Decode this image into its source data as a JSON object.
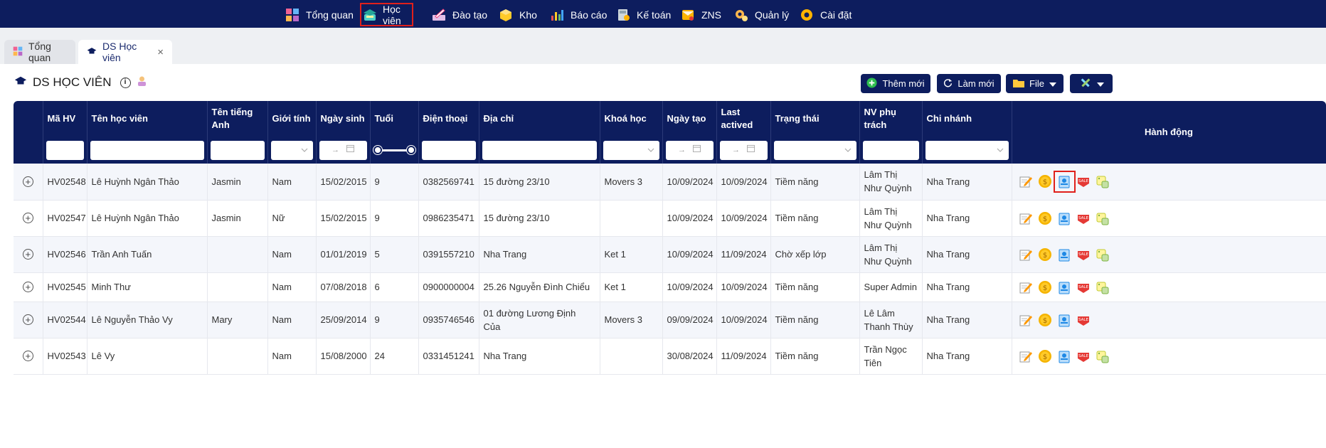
{
  "nav": [
    {
      "label": "Tổng quan",
      "icon": "dashboard-icon"
    },
    {
      "label": "Học viên",
      "icon": "student-cap-icon",
      "active": true
    },
    {
      "label": "Đào tạo",
      "icon": "training-icon"
    },
    {
      "label": "Kho",
      "icon": "warehouse-box-icon"
    },
    {
      "label": "Báo cáo",
      "icon": "report-chart-icon"
    },
    {
      "label": "Kế toán",
      "icon": "accounting-icon"
    },
    {
      "label": "ZNS",
      "icon": "zns-mail-icon"
    },
    {
      "label": "Quản lý",
      "icon": "management-icon"
    },
    {
      "label": "Cài đặt",
      "icon": "settings-gear-icon"
    }
  ],
  "tabs": {
    "overview": "Tổng quan",
    "students": "DS Học viên",
    "close": "×"
  },
  "page": {
    "title": "DS HỌC VIÊN",
    "info": "i"
  },
  "toolbar": {
    "add": "Thêm mới",
    "refresh": "Làm mới",
    "file": "File"
  },
  "columns": {
    "code": "Mã HV",
    "name": "Tên học viên",
    "english_name": "Tên tiếng Anh",
    "gender": "Giới tính",
    "dob": "Ngày sinh",
    "age": "Tuổi",
    "phone": "Điện thoại",
    "address": "Địa chỉ",
    "course": "Khoá học",
    "created": "Ngày tạo",
    "last_active": "Last actived",
    "status": "Trạng thái",
    "staff": "NV phụ trách",
    "branch": "Chi nhánh",
    "actions": "Hành động"
  },
  "filters": {
    "date_arrow": "→"
  },
  "rows": [
    {
      "code": "HV02548",
      "name": "Lê Huỳnh Ngân Thảo",
      "english_name": "Jasmin",
      "gender": "Nam",
      "dob": "15/02/2015",
      "age": "9",
      "phone": "0382569741",
      "address": "15 đường 23/10",
      "course": "Movers 3",
      "created": "10/09/2024",
      "last_active": "10/09/2024",
      "status": "Tiềm năng",
      "staff": "Lâm Thị Như Quỳnh",
      "branch": "Nha Trang"
    },
    {
      "code": "HV02547",
      "name": "Lê Huỳnh Ngân Thảo",
      "english_name": "Jasmin",
      "gender": "Nữ",
      "dob": "15/02/2015",
      "age": "9",
      "phone": "0986235471",
      "address": "15 đường 23/10",
      "course": "",
      "created": "10/09/2024",
      "last_active": "10/09/2024",
      "status": "Tiềm năng",
      "staff": "Lâm Thị Như Quỳnh",
      "branch": "Nha Trang"
    },
    {
      "code": "HV02546",
      "name": "Trần Anh Tuấn",
      "english_name": "",
      "gender": "Nam",
      "dob": "01/01/2019",
      "age": "5",
      "phone": "0391557210",
      "address": "Nha Trang",
      "course": "Ket 1",
      "created": "10/09/2024",
      "last_active": "11/09/2024",
      "status": "Chờ xếp lớp",
      "staff": "Lâm Thị Như Quỳnh",
      "branch": "Nha Trang"
    },
    {
      "code": "HV02545",
      "name": "Minh Thư",
      "english_name": "",
      "gender": "Nam",
      "dob": "07/08/2018",
      "age": "6",
      "phone": "0900000004",
      "address": "25.26 Nguyễn Đình Chiểu",
      "course": "Ket 1",
      "created": "10/09/2024",
      "last_active": "10/09/2024",
      "status": "Tiềm năng",
      "staff": "Super Admin",
      "branch": "Nha Trang"
    },
    {
      "code": "HV02544",
      "name": "Lê Nguyễn Thảo Vy",
      "english_name": "Mary",
      "gender": "Nam",
      "dob": "25/09/2014",
      "age": "9",
      "phone": "0935746546",
      "address": "01 đường Lương Định Của",
      "course": "Movers 3",
      "created": "09/09/2024",
      "last_active": "10/09/2024",
      "status": "Tiềm năng",
      "staff": "Lê Lâm Thanh Thùy",
      "branch": "Nha Trang"
    },
    {
      "code": "HV02543",
      "name": "Lê Vy",
      "english_name": "",
      "gender": "Nam",
      "dob": "15/08/2000",
      "age": "24",
      "phone": "0331451241",
      "address": "Nha Trang",
      "course": "",
      "created": "30/08/2024",
      "last_active": "11/09/2024",
      "status": "Tiềm năng",
      "staff": "Trần Ngọc Tiên",
      "branch": "Nha Trang"
    }
  ],
  "action_icons": [
    "edit-icon",
    "payment-coin-icon",
    "enroll-document-icon",
    "sale-tag-icon",
    "schedule-dice-icon"
  ],
  "colors": {
    "nav_bg": "#0d1d5e",
    "highlight": "#e0201b"
  }
}
